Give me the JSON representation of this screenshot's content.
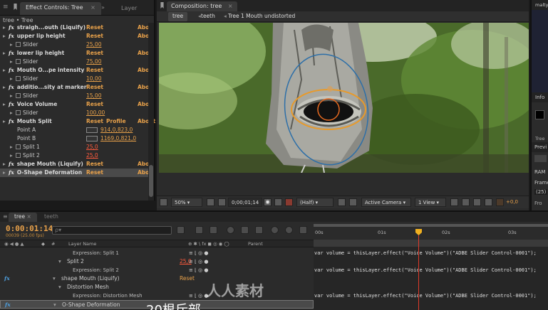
{
  "effect_controls": {
    "tab_label": "Effect Controls: Tree",
    "other_tab": "Layer",
    "crumb": "tree • Tree",
    "rows": [
      {
        "type": "fx",
        "name": "straigh...outh (Liquify)",
        "reset": "Reset",
        "about": "Abo"
      },
      {
        "type": "fx",
        "name": "upper lip height",
        "reset": "Reset",
        "about": "Abo"
      },
      {
        "type": "prop",
        "name": "Slider",
        "value": "25,00"
      },
      {
        "type": "fx",
        "name": "lower lip height",
        "reset": "Reset",
        "about": "Abo"
      },
      {
        "type": "prop",
        "name": "Slider",
        "value": "75,00"
      },
      {
        "type": "fx",
        "name": "Mouth O...pe intensity",
        "reset": "Reset",
        "about": "Abo"
      },
      {
        "type": "prop",
        "name": "Slider",
        "value": "10,00"
      },
      {
        "type": "fx",
        "name": "additio...sity at marker",
        "reset": "Reset",
        "about": "Abo"
      },
      {
        "type": "prop",
        "name": "Slider",
        "value": "15,00"
      },
      {
        "type": "fx",
        "name": "Voice Volume",
        "reset": "Reset",
        "about": "Abo"
      },
      {
        "type": "prop",
        "name": "Slider",
        "value": "100,00"
      },
      {
        "type": "fx",
        "name": "Mouth Split",
        "reset": "Reset",
        "profile": "Profile",
        "about": "About"
      },
      {
        "type": "point",
        "name": "Point A",
        "value": "914,0,823,0"
      },
      {
        "type": "point",
        "name": "Point B",
        "value": "1169,0,821,0"
      },
      {
        "type": "prop",
        "name": "Split 1",
        "value": "25,0",
        "red": true
      },
      {
        "type": "prop",
        "name": "Split 2",
        "value": "25,0",
        "red": true
      },
      {
        "type": "fx",
        "name": "shape Mouth (Liquify)",
        "reset": "Reset",
        "about": "Abo"
      },
      {
        "type": "fx",
        "name": "O-Shape Deformation",
        "reset": "Reset",
        "about": "Abo",
        "selected": true
      }
    ]
  },
  "composition": {
    "tab_label": "Composition: tree",
    "crumbs": [
      "tree",
      "teeth",
      "Tree 1 Mouth undistorted"
    ],
    "toolbar": {
      "zoom": "50%",
      "timecode": "0;00;01;14",
      "resolution": "(Half)",
      "camera": "Active Camera",
      "view": "1 View",
      "exposure": "+0,0"
    }
  },
  "right_panel": {
    "top_tab": "malty",
    "info_label": "Info",
    "preview_label": "Previ",
    "ram_label": "RAM",
    "frame_label": "Frame",
    "frame_value": "(25)",
    "from_label": "Fro",
    "tree_label": "Tree"
  },
  "timeline": {
    "tabs": [
      "tree",
      "teeth"
    ],
    "timecode": "0:00:01:14",
    "fps": "00039 (25.00 fps)",
    "search_placeholder": "ρ▾",
    "col_layer_name": "Layer Name",
    "col_parent": "Parent",
    "ruler": [
      "00s",
      "01s",
      "02s",
      "03s"
    ],
    "rows": [
      {
        "indent": 4,
        "label": "Expression: Split 1",
        "sub": true
      },
      {
        "indent": 3,
        "label": "Split 2",
        "value": "25,0",
        "red": true
      },
      {
        "indent": 4,
        "label": "Expression: Split 2",
        "sub": true
      },
      {
        "indent": 2,
        "label": "shape Mouth (Liquify)",
        "reset": "Reset",
        "fx": true
      },
      {
        "indent": 3,
        "label": "Distortion Mesh"
      },
      {
        "indent": 4,
        "label": "Expression: Distortion Mesh",
        "sub": true
      },
      {
        "indent": 2,
        "label": "O-Shape Deformation",
        "fx": true,
        "selected": true
      }
    ],
    "expressions": [
      "var volume = thisLayer.effect(\"Voice Volume\")(\"ADBE Slider Control-0001\");",
      "var volume = thisLayer.effect(\"Voice Volume\")(\"ADBE Slider Control-0001\");",
      "var volume = thisLayer.effect(\"Voice Volume\")(\"ADBE Slider Control-0001\");"
    ]
  },
  "overlay": {
    "watermark": "人人素材",
    "subtitle": "20根斥部"
  }
}
